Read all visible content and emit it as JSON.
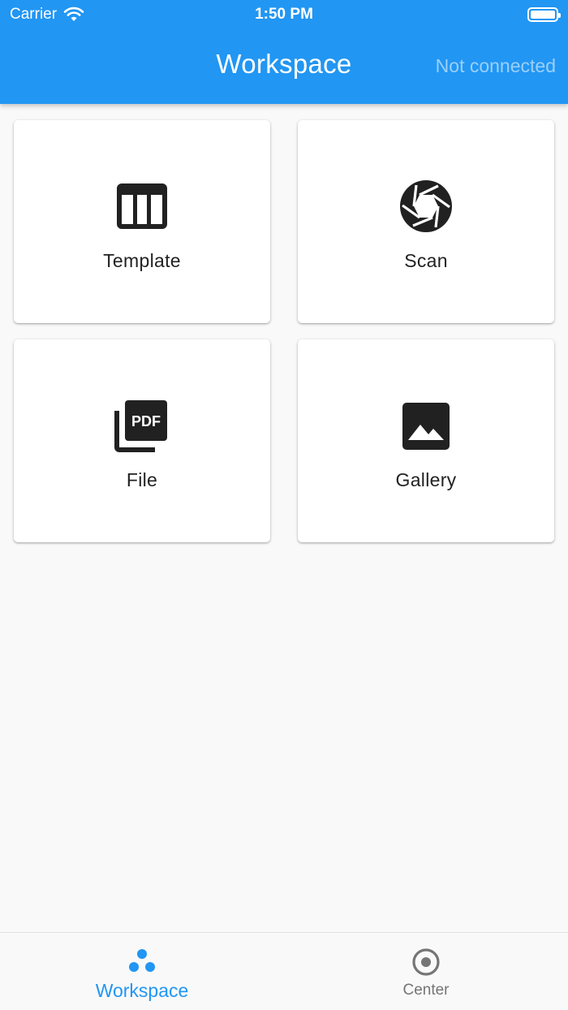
{
  "status_bar": {
    "carrier": "Carrier",
    "time": "1:50 PM"
  },
  "header": {
    "title": "Workspace",
    "connection_status": "Not connected"
  },
  "tiles": [
    {
      "label": "Template",
      "icon": "table-icon"
    },
    {
      "label": "Scan",
      "icon": "camera-aperture-icon"
    },
    {
      "label": "File",
      "icon": "pdf-file-icon"
    },
    {
      "label": "Gallery",
      "icon": "image-icon"
    }
  ],
  "bottom_nav": {
    "items": [
      {
        "label": "Workspace",
        "icon": "workspace-dots-icon",
        "active": true
      },
      {
        "label": "Center",
        "icon": "radio-target-icon",
        "active": false
      }
    ]
  },
  "colors": {
    "primary": "#2196f3",
    "background": "#f9f9f9",
    "icon": "#212121",
    "inactive": "#757575"
  }
}
